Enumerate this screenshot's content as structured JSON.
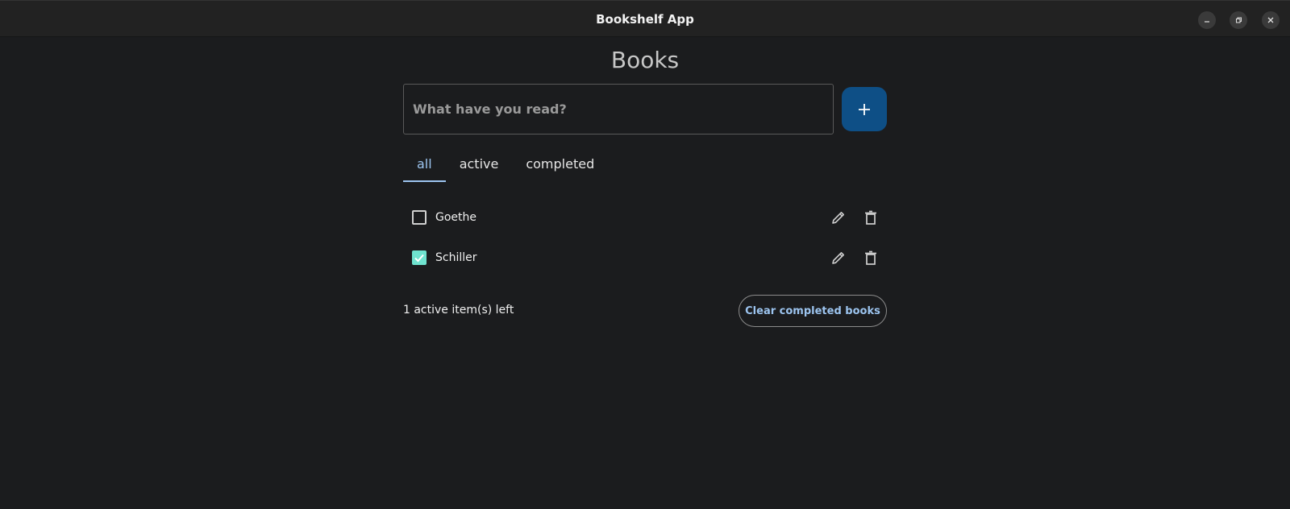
{
  "window": {
    "title": "Bookshelf App",
    "controls": [
      "minimize-icon",
      "maximize-icon",
      "close-icon"
    ]
  },
  "page": {
    "title": "Books"
  },
  "input": {
    "placeholder": "What have you read?",
    "value": ""
  },
  "add_button": {
    "icon": "plus-icon",
    "color": "#0e4f86"
  },
  "tabs": [
    {
      "label": "all",
      "selected": true
    },
    {
      "label": "active",
      "selected": false
    },
    {
      "label": "completed",
      "selected": false
    }
  ],
  "books": [
    {
      "title": "Goethe",
      "completed": false
    },
    {
      "title": "Schiller",
      "completed": true
    }
  ],
  "footer": {
    "count_text": "1 active item(s) left",
    "clear_label": "Clear completed books"
  },
  "colors": {
    "accent": "#9cc4ef",
    "checkbox_checked": "#6fe3cf",
    "background": "#1b1c1e"
  }
}
